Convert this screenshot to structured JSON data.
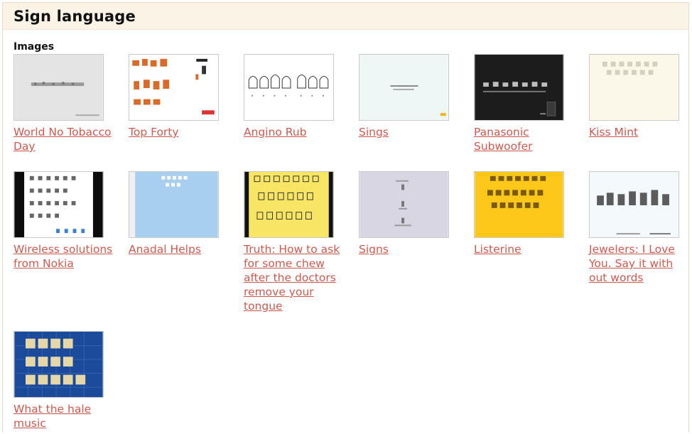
{
  "page": {
    "title": "Sign language",
    "section_label": "Images"
  },
  "images": [
    {
      "caption": "World No Tobacco Day"
    },
    {
      "caption": "Top Forty"
    },
    {
      "caption": "Angino Rub"
    },
    {
      "caption": "Sings"
    },
    {
      "caption": "Panasonic Subwoofer"
    },
    {
      "caption": "Kiss Mint"
    },
    {
      "caption": "Wireless solutions from Nokia"
    },
    {
      "caption": "Anadal Helps"
    },
    {
      "caption": "Truth: How to ask for some chew after the doctors remove your tongue"
    },
    {
      "caption": "Signs"
    },
    {
      "caption": "Listerine"
    },
    {
      "caption": "Jewelers: I Love You. Say it with out words"
    },
    {
      "caption": "What the hale music"
    }
  ],
  "colors": {
    "link": "#cc5a50",
    "header_bg": "#fbf3e6"
  }
}
